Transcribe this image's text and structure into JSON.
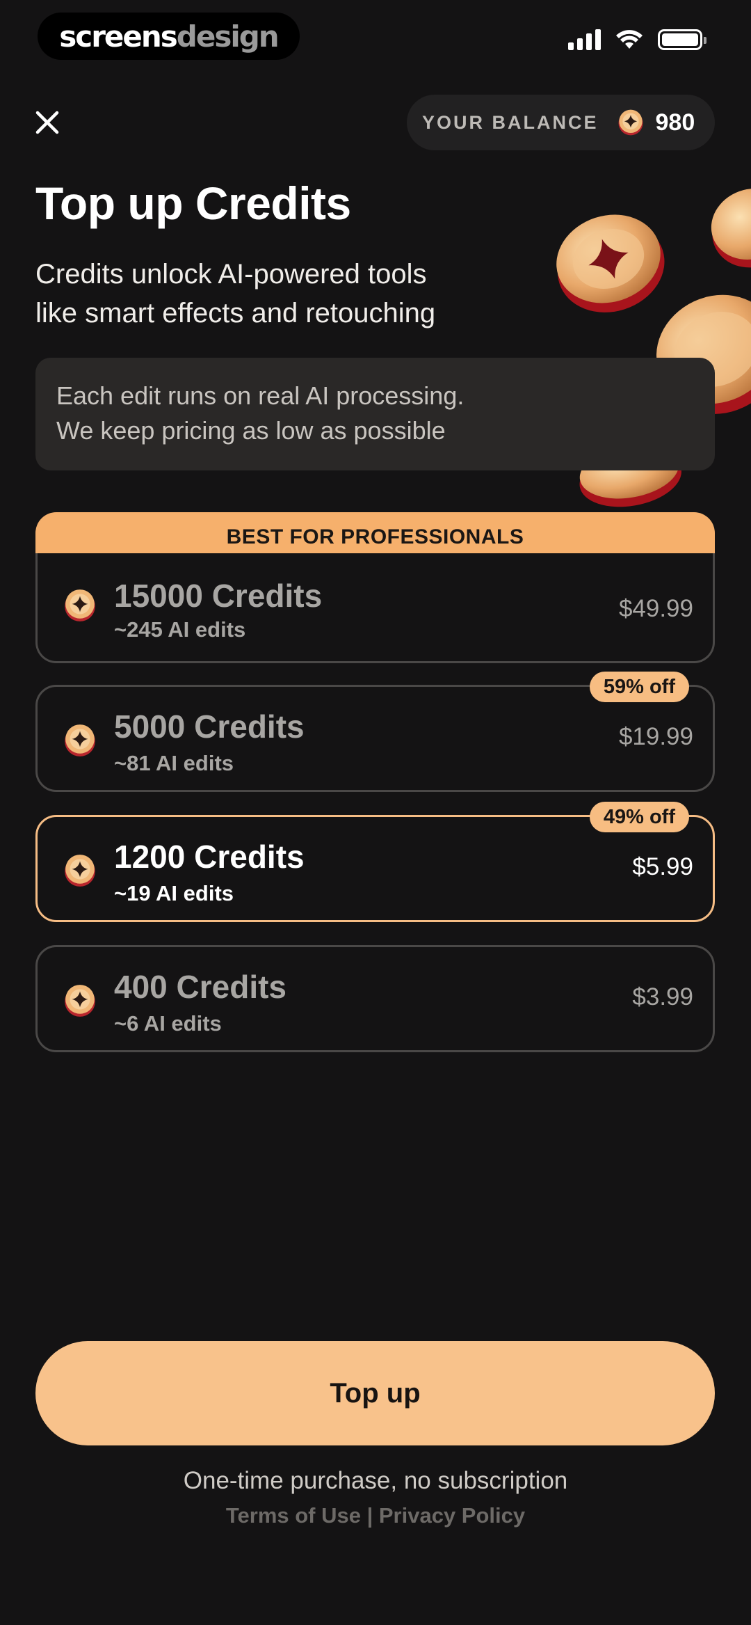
{
  "status_bar": {
    "brand_part1": "screens",
    "brand_part2": "design"
  },
  "header": {
    "balance_label": "YOUR BALANCE",
    "balance_value": "980"
  },
  "title": "Top up Credits",
  "subtitle_line1": "Credits unlock AI-powered tools",
  "subtitle_line2": "like smart effects and retouching",
  "info_line1": "Each edit runs on real AI processing.",
  "info_line2": "We keep pricing as low as possible",
  "packages": [
    {
      "badge": "BEST FOR PROFESSIONALS",
      "name": "15000 Credits",
      "edits": "~245 AI edits",
      "price": "$49.99"
    },
    {
      "discount": "59% off",
      "name": "5000 Credits",
      "edits": "~81 AI edits",
      "price": "$19.99"
    },
    {
      "discount": "49% off",
      "name": "1200 Credits",
      "edits": "~19 AI edits",
      "price": "$5.99",
      "selected": true
    },
    {
      "name": "400 Credits",
      "edits": "~6 AI edits",
      "price": "$3.99"
    }
  ],
  "cta_label": "Top up",
  "footnote": "One-time purchase, no subscription",
  "links": "Terms of Use | Privacy Policy",
  "colors": {
    "background": "#141314",
    "accent": "#f8c28b",
    "badge": "#f6b06c"
  },
  "icons": [
    "close-icon",
    "coin-icon",
    "signal-icon",
    "wifi-icon",
    "battery-icon"
  ]
}
